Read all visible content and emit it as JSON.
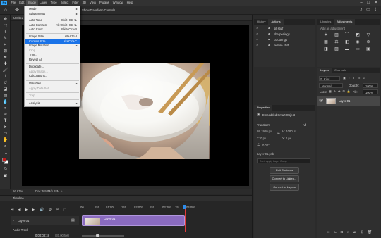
{
  "menubar": {
    "items": [
      "File",
      "Edit",
      "Image",
      "Layer",
      "Type",
      "Select",
      "Filter",
      "3D",
      "View",
      "Plugins",
      "Window",
      "Help"
    ]
  },
  "options_bar": {
    "transform_controls": "Show Transform Controls"
  },
  "document_tab": {
    "title": "Untitled"
  },
  "image_menu": {
    "items": [
      {
        "label": "Mode",
        "shortcut": "",
        "submenu": true,
        "disabled": false
      },
      {
        "label": "Adjustments",
        "shortcut": "",
        "submenu": true,
        "disabled": false
      },
      {
        "sep": true
      },
      {
        "label": "Auto Tone",
        "shortcut": "Shift+Ctrl+L",
        "disabled": false
      },
      {
        "label": "Auto Contrast",
        "shortcut": "Alt+Shift+Ctrl+L",
        "disabled": false
      },
      {
        "label": "Auto Color",
        "shortcut": "Shift+Ctrl+B",
        "disabled": false
      },
      {
        "sep": true
      },
      {
        "label": "Image Size...",
        "shortcut": "Alt+Ctrl+I",
        "disabled": false
      },
      {
        "label": "Canvas Size...",
        "shortcut": "Alt+Ctrl+C",
        "disabled": false,
        "highlight": true
      },
      {
        "label": "Image Rotation",
        "shortcut": "",
        "submenu": true,
        "disabled": false
      },
      {
        "label": "Crop",
        "shortcut": "",
        "disabled": true
      },
      {
        "label": "Trim...",
        "shortcut": "",
        "disabled": false
      },
      {
        "label": "Reveal All",
        "shortcut": "",
        "disabled": false
      },
      {
        "sep": true
      },
      {
        "label": "Duplicate...",
        "shortcut": "",
        "disabled": false
      },
      {
        "label": "Apply Image...",
        "shortcut": "",
        "disabled": true
      },
      {
        "label": "Calculations...",
        "shortcut": "",
        "disabled": false
      },
      {
        "sep": true
      },
      {
        "label": "Variables",
        "shortcut": "",
        "submenu": true,
        "disabled": false
      },
      {
        "label": "Apply Data Set...",
        "shortcut": "",
        "disabled": true
      },
      {
        "sep": true
      },
      {
        "label": "Trap...",
        "shortcut": "",
        "disabled": true
      },
      {
        "sep": true
      },
      {
        "label": "Analysis",
        "shortcut": "",
        "submenu": true,
        "disabled": false
      }
    ]
  },
  "status": {
    "zoom": "66.67%",
    "doc": "Doc: 5.93M/5.93M"
  },
  "timeline": {
    "title": "Timeline",
    "time_marks": [
      "00",
      "15f",
      "01:00f",
      "15f",
      "02:00f",
      "15f",
      "03:00f",
      "15f",
      "04:00f"
    ],
    "layer_label": "Layer 01",
    "clip_label": "Layer 01",
    "audio_label": "Audio Track",
    "time": "0:00:03:18",
    "fps": "(30.00 fps)"
  },
  "history_panel": {
    "tabs": [
      "History",
      "Actions"
    ],
    "items": [
      "gif stuff",
      "sharpenings",
      "colourings",
      "picture stuff"
    ]
  },
  "libraries_panel": {
    "tabs": [
      "Libraries",
      "Adjustments"
    ],
    "subtitle": "Add an adjustment"
  },
  "properties_panel": {
    "tab": "Properties",
    "object": "Embedded Smart Object",
    "transform_title": "Transform",
    "w": "W:  1920 px",
    "h": "H:  1080 px",
    "x": "X:  0 px",
    "y": "Y:  0 px",
    "angle": "0.00°",
    "layer_path": "Layer 01.psb",
    "comp_placeholder": "Don't Apply Layer Comp",
    "buttons": [
      "Edit Contents",
      "Convert to Linked...",
      "Convert to Layers"
    ]
  },
  "layers_panel": {
    "tabs": [
      "Layers",
      "Channels"
    ],
    "kind": "Kind",
    "blend": "Normal",
    "opacity_label": "Opacity:",
    "opacity": "100%",
    "lock_label": "Lock:",
    "fill_label": "Fill:",
    "fill": "100%",
    "layer_name": "Layer 01"
  }
}
